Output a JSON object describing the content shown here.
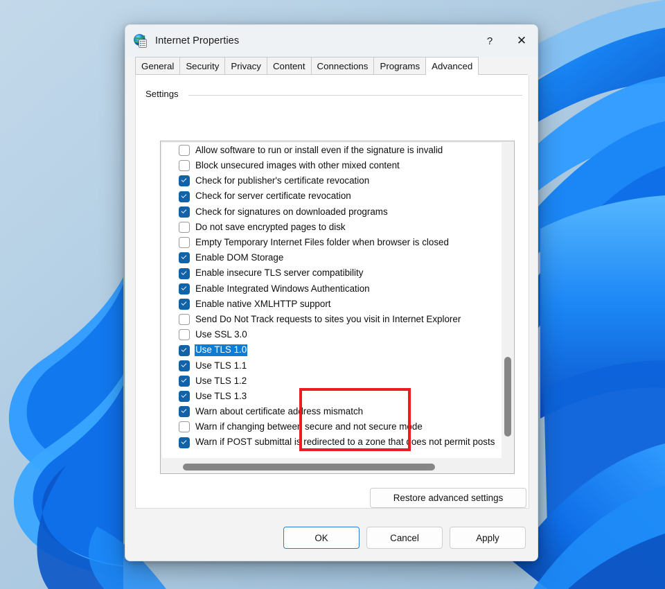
{
  "window": {
    "title": "Internet Properties",
    "icon": "internet-properties-icon",
    "help_label": "?",
    "close_label": "✕"
  },
  "tabs": [
    {
      "label": "General",
      "active": false
    },
    {
      "label": "Security",
      "active": false
    },
    {
      "label": "Privacy",
      "active": false
    },
    {
      "label": "Content",
      "active": false
    },
    {
      "label": "Connections",
      "active": false
    },
    {
      "label": "Programs",
      "active": false
    },
    {
      "label": "Advanced",
      "active": true
    }
  ],
  "group": {
    "label": "Settings"
  },
  "settings_list": [
    {
      "label": "Allow software to run or install even if the signature is invalid",
      "checked": false,
      "selected": false
    },
    {
      "label": "Block unsecured images with other mixed content",
      "checked": false,
      "selected": false
    },
    {
      "label": "Check for publisher's certificate revocation",
      "checked": true,
      "selected": false
    },
    {
      "label": "Check for server certificate revocation",
      "checked": true,
      "selected": false
    },
    {
      "label": "Check for signatures on downloaded programs",
      "checked": true,
      "selected": false
    },
    {
      "label": "Do not save encrypted pages to disk",
      "checked": false,
      "selected": false
    },
    {
      "label": "Empty Temporary Internet Files folder when browser is closed",
      "checked": false,
      "selected": false
    },
    {
      "label": "Enable DOM Storage",
      "checked": true,
      "selected": false
    },
    {
      "label": "Enable insecure TLS server compatibility",
      "checked": true,
      "selected": false
    },
    {
      "label": "Enable Integrated Windows Authentication",
      "checked": true,
      "selected": false
    },
    {
      "label": "Enable native XMLHTTP support",
      "checked": true,
      "selected": false
    },
    {
      "label": "Send Do Not Track requests to sites you visit in Internet Explorer",
      "checked": false,
      "selected": false
    },
    {
      "label": "Use SSL 3.0",
      "checked": false,
      "selected": false
    },
    {
      "label": "Use TLS 1.0",
      "checked": true,
      "selected": true
    },
    {
      "label": "Use TLS 1.1",
      "checked": true,
      "selected": false
    },
    {
      "label": "Use TLS 1.2",
      "checked": true,
      "selected": false
    },
    {
      "label": "Use TLS 1.3",
      "checked": true,
      "selected": false
    },
    {
      "label": "Warn about certificate address mismatch",
      "checked": true,
      "selected": false
    },
    {
      "label": "Warn if changing between secure and not secure mode",
      "checked": false,
      "selected": false
    },
    {
      "label": "Warn if POST submittal is redirected to a zone that does not permit posts",
      "checked": true,
      "selected": false
    }
  ],
  "buttons": {
    "restore": "Restore advanced settings",
    "ok": "OK",
    "cancel": "Cancel",
    "apply": "Apply"
  },
  "annotation": {
    "color": "#ed1c24",
    "targets": [
      "Use TLS 1.0",
      "Use TLS 1.1",
      "Use TLS 1.2",
      "Use TLS 1.3"
    ]
  },
  "colors": {
    "accent": "#0c7cd5",
    "checkbox": "#1063a8",
    "annotation_red": "#ed1c24",
    "window_bg": "#f3f3f3",
    "desktop_blue": "#0b61d8"
  }
}
